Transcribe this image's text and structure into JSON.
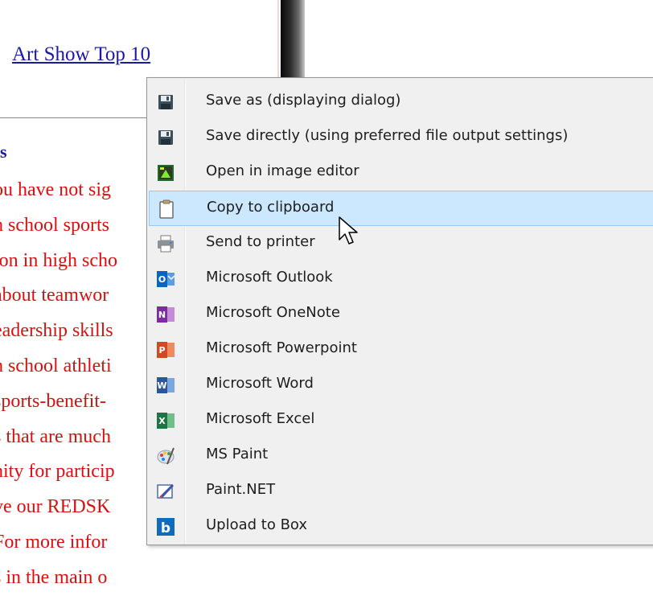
{
  "page": {
    "link": "Art Show Top 10",
    "heading": "s",
    "lines": [
      "ou have not sig",
      "h school sports",
      "ion in high scho",
      "about teamwor",
      "eadership skills",
      "h school athleti",
      "sports-benefit-",
      "s that are much",
      "nity for particip",
      "ve our REDSK",
      "For more infor",
      "s in the main o"
    ]
  },
  "menu": {
    "items": [
      {
        "label": "Save as (displaying dialog)",
        "icon": "floppy-disk-icon"
      },
      {
        "label": "Save directly (using preferred file output settings)",
        "icon": "floppy-disk-icon"
      },
      {
        "label": "Open in image editor",
        "icon": "image-editor-icon"
      },
      {
        "label": "Copy to clipboard",
        "icon": "clipboard-icon",
        "highlighted": true
      },
      {
        "label": "Send to printer",
        "icon": "printer-icon"
      },
      {
        "label": "Microsoft Outlook",
        "icon": "outlook-icon"
      },
      {
        "label": "Microsoft OneNote",
        "icon": "onenote-icon"
      },
      {
        "label": "Microsoft Powerpoint",
        "icon": "powerpoint-icon"
      },
      {
        "label": "Microsoft Word",
        "icon": "word-icon"
      },
      {
        "label": "Microsoft Excel",
        "icon": "excel-icon"
      },
      {
        "label": "MS Paint",
        "icon": "ms-paint-icon"
      },
      {
        "label": "Paint.NET",
        "icon": "paint-net-icon"
      },
      {
        "label": "Upload to Box",
        "icon": "box-icon"
      }
    ]
  },
  "colors": {
    "highlight": "#cce8ff",
    "menu_bg": "#f0f0f0",
    "page_text": "#d81010",
    "link": "#1a1aa6"
  }
}
